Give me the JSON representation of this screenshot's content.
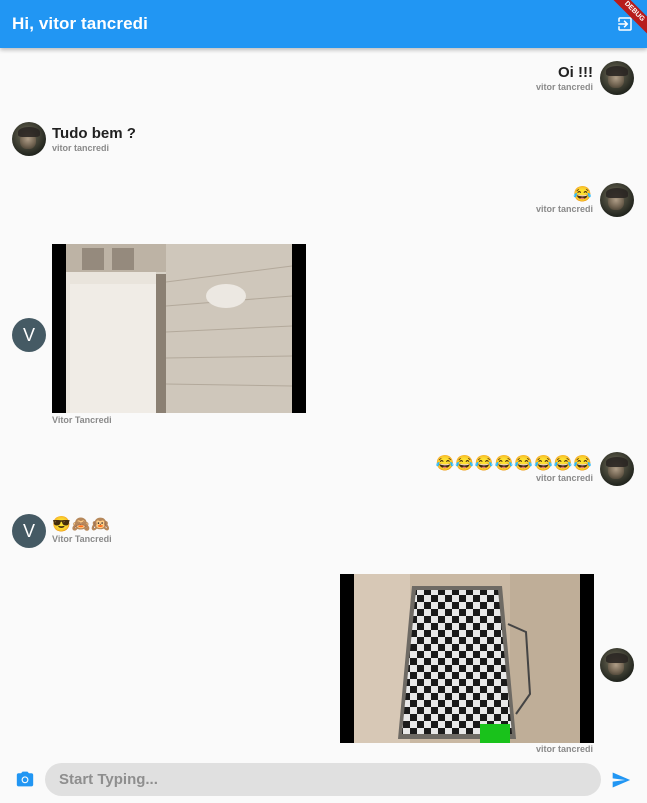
{
  "appbar": {
    "title": "Hi, vitor tancredi",
    "logout_icon": "logout-icon",
    "debug_label": "DEBUG",
    "color": "#2196f3"
  },
  "messages": [
    {
      "side": "right",
      "type": "text",
      "text": "Oi !!!",
      "sender": "vitor tancredi"
    },
    {
      "side": "left",
      "type": "text",
      "text": "Tudo bem ?",
      "sender": "vitor tancredi"
    },
    {
      "side": "right",
      "type": "emoji",
      "text": "😂",
      "sender": "vitor tancredi"
    },
    {
      "side": "left",
      "type": "image",
      "avatar_letter": "V",
      "sender": "Vitor Tancredi"
    },
    {
      "side": "right",
      "type": "emoji",
      "text": "😂😂😂😂😂😂😂😂",
      "sender": "vitor tancredi"
    },
    {
      "side": "left",
      "type": "emoji",
      "avatar_letter": "V",
      "text": "😎🙈🙉",
      "sender": "Vitor Tancredi"
    },
    {
      "side": "right",
      "type": "image",
      "sender": "vitor tancredi"
    }
  ],
  "composer": {
    "placeholder": "Start Typing...",
    "camera_icon": "camera-icon",
    "send_icon": "send-icon",
    "accent": "#2196f3"
  }
}
